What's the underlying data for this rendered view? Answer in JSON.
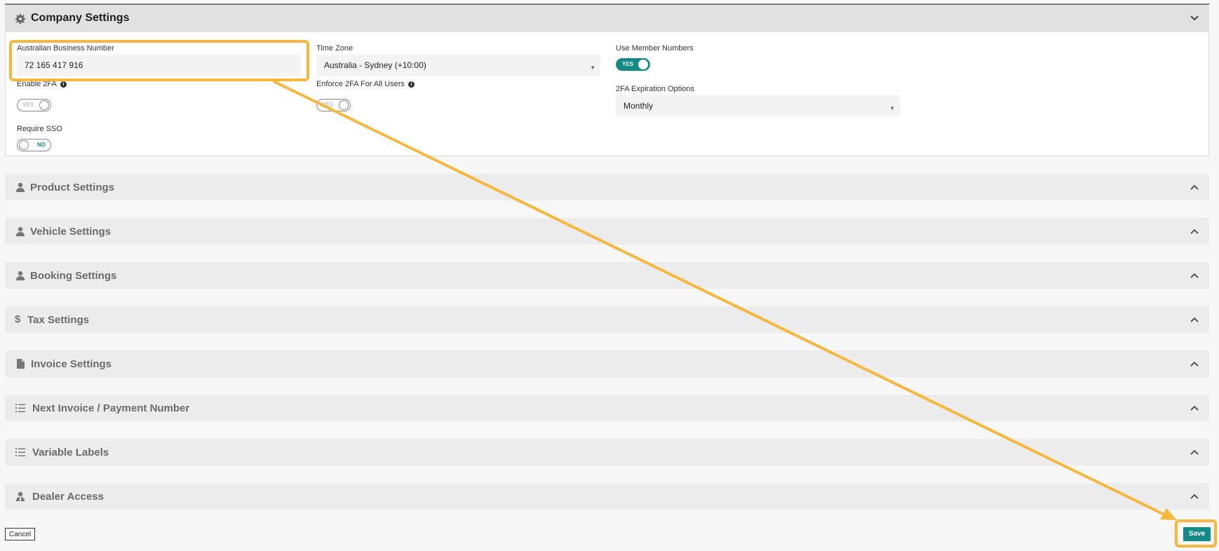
{
  "company": {
    "title": "Company Settings",
    "abn_label": "Australian Business Number",
    "abn_value": "72 165 417 916",
    "timezone_label": "Time Zone",
    "timezone_value": "Australia - Sydney (+10:00)",
    "member_numbers_label": "Use Member Numbers",
    "member_numbers_toggle": "YES",
    "enable_2fa_label": "Enable 2FA",
    "enable_2fa_toggle": "YES",
    "enforce_2fa_label": "Enforce 2FA For All Users",
    "enforce_2fa_toggle": "YES",
    "expiration_label": "2FA Expiration Options",
    "expiration_value": "Monthly",
    "sso_label": "Require SSO",
    "sso_toggle": "NO"
  },
  "sections": [
    {
      "label": "Product Settings",
      "icon": "user-icon"
    },
    {
      "label": "Vehicle Settings",
      "icon": "user-icon"
    },
    {
      "label": "Booking Settings",
      "icon": "user-icon"
    },
    {
      "label": "Tax Settings",
      "icon": "dollar-icon"
    },
    {
      "label": "Invoice Settings",
      "icon": "file-icon"
    },
    {
      "label": "Next Invoice / Payment Number",
      "icon": "list-icon"
    },
    {
      "label": "Variable Labels",
      "icon": "list-icon"
    },
    {
      "label": "Dealer Access",
      "icon": "user-tie-icon"
    }
  ],
  "buttons": {
    "cancel": "Cancel",
    "save": "Save"
  },
  "colors": {
    "accent": "#138a86",
    "annotation": "#f6b73c"
  }
}
